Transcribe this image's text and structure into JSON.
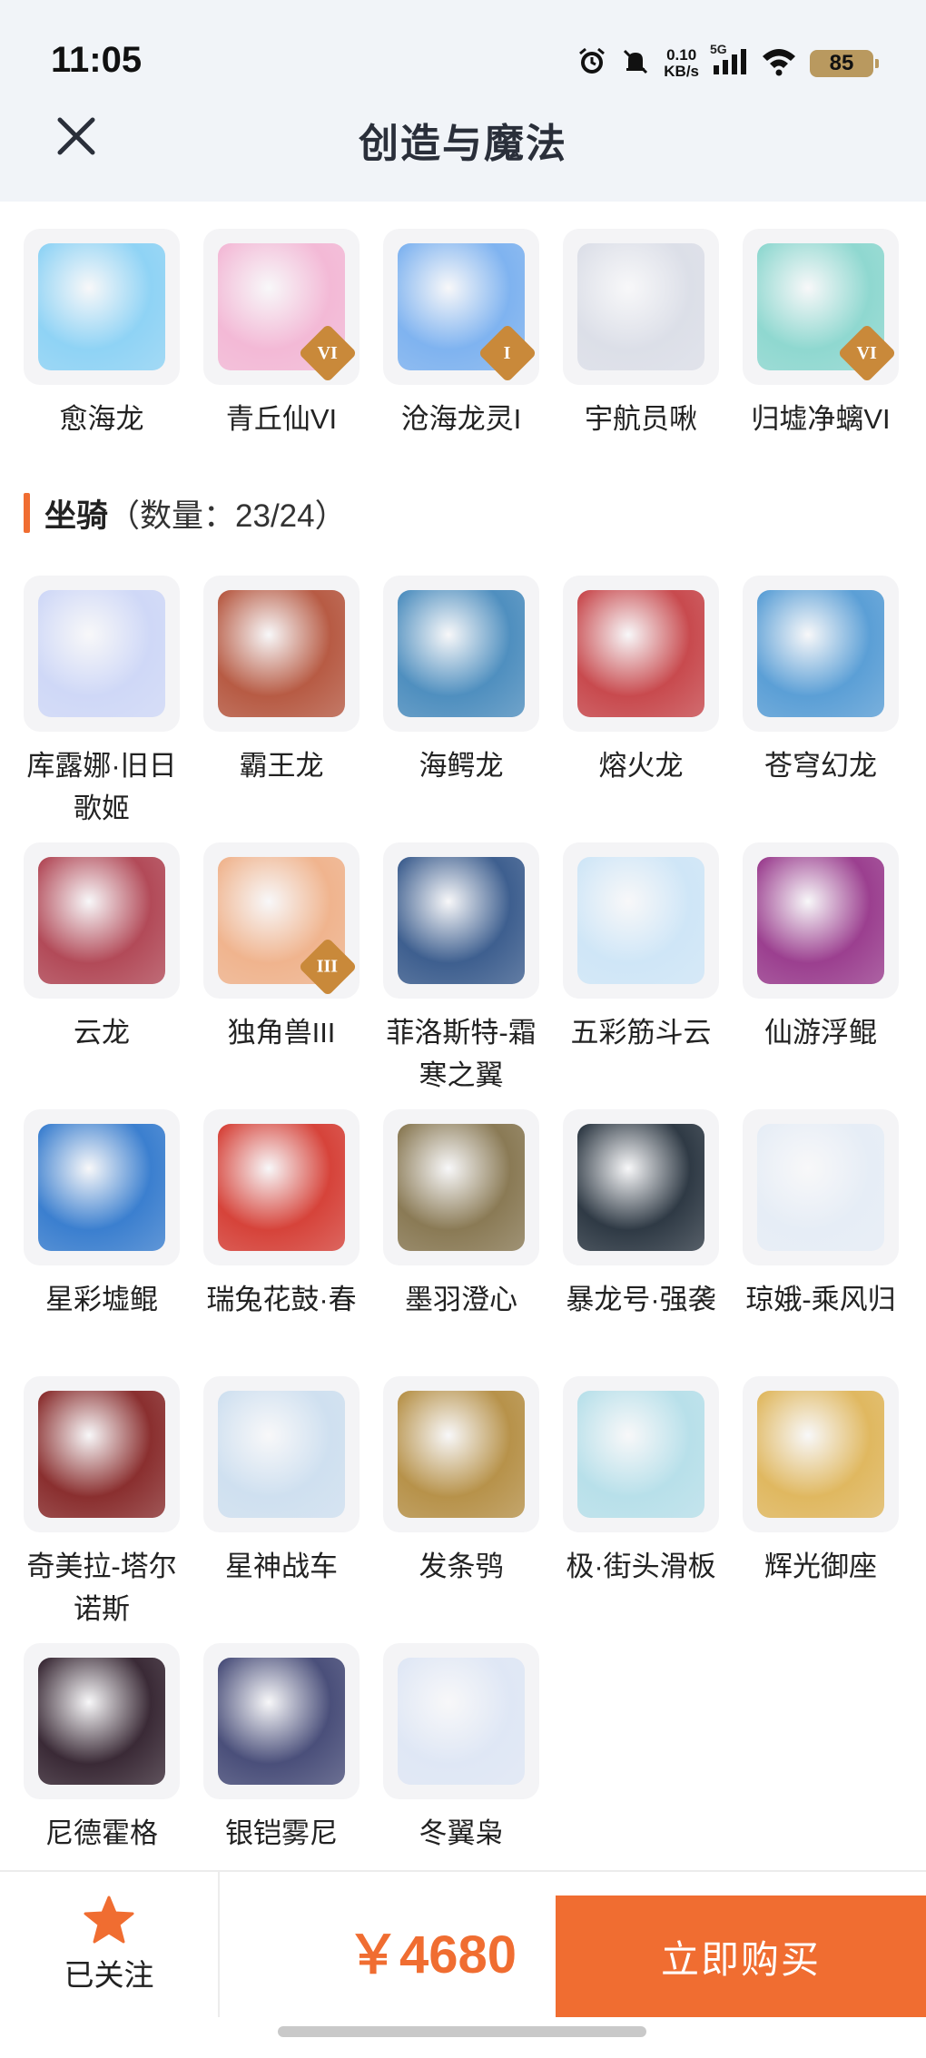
{
  "status_bar": {
    "time": "11:05",
    "net_speed_value": "0.10",
    "net_speed_unit": "KB/s",
    "network": "5G",
    "battery": "85"
  },
  "header": {
    "title": "创造与魔法",
    "close_icon": "close-icon"
  },
  "top_row": [
    {
      "label": "愈海龙",
      "color": "#8fd3f5",
      "badge": ""
    },
    {
      "label": "青丘仙VI",
      "color": "#f3b9d6",
      "badge": "VI"
    },
    {
      "label": "沧海龙灵I",
      "color": "#7fb3f0",
      "badge": "I"
    },
    {
      "label": "宇航员啾",
      "color": "#dcdfe8",
      "badge": ""
    },
    {
      "label": "归墟净螭VI",
      "color": "#8fd8d0",
      "badge": "VI"
    }
  ],
  "section": {
    "title": "坐骑",
    "count": "（数量：23/24）",
    "accent": "#f06d31"
  },
  "mounts": [
    {
      "label": "库露娜·旧日歌姬",
      "color": "#cfd8f7",
      "badge": ""
    },
    {
      "label": "霸王龙",
      "color": "#b75b44",
      "badge": ""
    },
    {
      "label": "海鳄龙",
      "color": "#4f8fbf",
      "badge": ""
    },
    {
      "label": "熔火龙",
      "color": "#c84a4e",
      "badge": ""
    },
    {
      "label": "苍穹幻龙",
      "color": "#5b9fd6",
      "badge": ""
    },
    {
      "label": "云龙",
      "color": "#b24a58",
      "badge": ""
    },
    {
      "label": "独角兽III",
      "color": "#f0b48e",
      "badge": "III"
    },
    {
      "label": "菲洛斯特-霜寒之翼",
      "color": "#3e5f8f",
      "badge": ""
    },
    {
      "label": "五彩筋斗云",
      "color": "#cfe6f7",
      "badge": ""
    },
    {
      "label": "仙游浮鲲",
      "color": "#9b3f8f",
      "badge": ""
    },
    {
      "label": "星彩墟鲲",
      "color": "#3b7fcf",
      "badge": ""
    },
    {
      "label": "瑞兔花鼓·春",
      "color": "#d6433a",
      "badge": ""
    },
    {
      "label": "墨羽澄心",
      "color": "#8a7a55",
      "badge": ""
    },
    {
      "label": "暴龙号·强袭",
      "color": "#2f3a45",
      "badge": ""
    },
    {
      "label": "琼娥-乘风归",
      "color": "#e6edf6",
      "badge": ""
    },
    {
      "label": "奇美拉-塔尔诺斯",
      "color": "#8a2f2f",
      "badge": ""
    },
    {
      "label": "星神战车",
      "color": "#cfe0f0",
      "badge": ""
    },
    {
      "label": "发条鸮",
      "color": "#b7924a",
      "badge": ""
    },
    {
      "label": "极·街头滑板",
      "color": "#b8e0ea",
      "badge": ""
    },
    {
      "label": "辉光御座",
      "color": "#e0b860",
      "badge": ""
    },
    {
      "label": "尼德霍格",
      "color": "#3a2a36",
      "badge": ""
    },
    {
      "label": "银铠雾尼",
      "color": "#4a4f7a",
      "badge": ""
    },
    {
      "label": "冬翼枭",
      "color": "#dfe7f5",
      "badge": ""
    }
  ],
  "bottom_bar": {
    "follow_label": "已关注",
    "star_icon": "star-icon",
    "price": "￥4680",
    "buy_label": "立即购买"
  }
}
